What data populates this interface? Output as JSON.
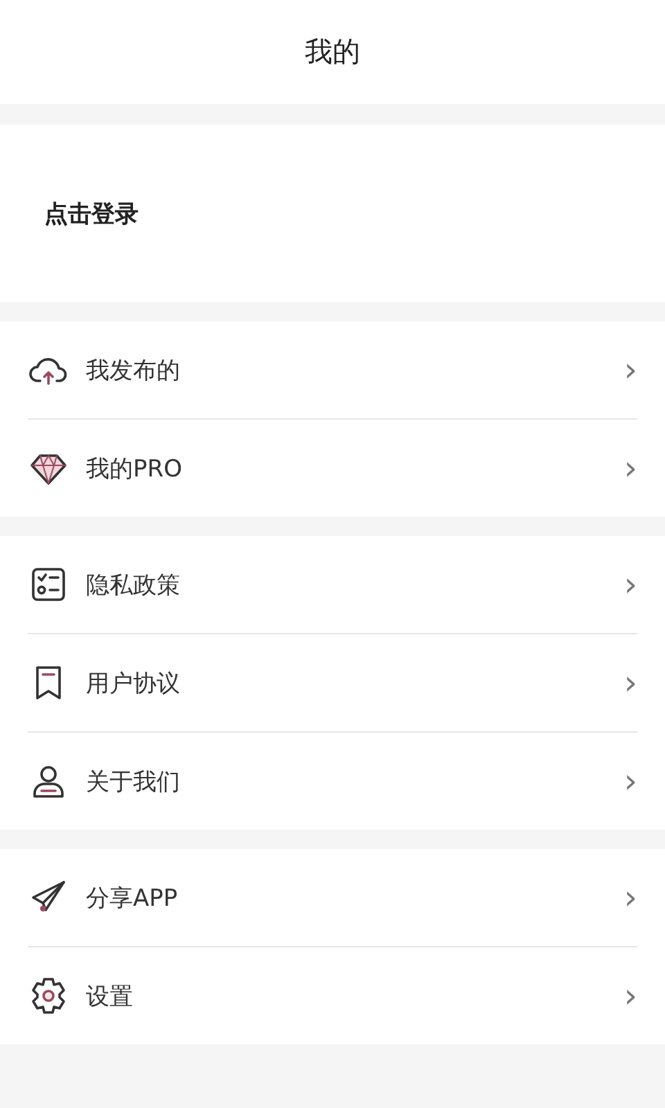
{
  "header": {
    "title": "我的"
  },
  "login": {
    "label": "点击登录"
  },
  "groups": [
    {
      "items": [
        {
          "kind": "cloud",
          "label": "我发布的",
          "chevron": "›"
        },
        {
          "kind": "diamond",
          "label": "我的PRO",
          "chevron": "›"
        }
      ]
    },
    {
      "items": [
        {
          "kind": "checklist",
          "label": "隐私政策",
          "chevron": "›"
        },
        {
          "kind": "bookmark",
          "label": "用户协议",
          "chevron": "›"
        },
        {
          "kind": "person",
          "label": "关于我们",
          "chevron": "›"
        }
      ]
    },
    {
      "items": [
        {
          "kind": "plane",
          "label": "分享APP",
          "chevron": "›"
        },
        {
          "kind": "gear",
          "label": "设置",
          "chevron": "›"
        }
      ]
    }
  ]
}
